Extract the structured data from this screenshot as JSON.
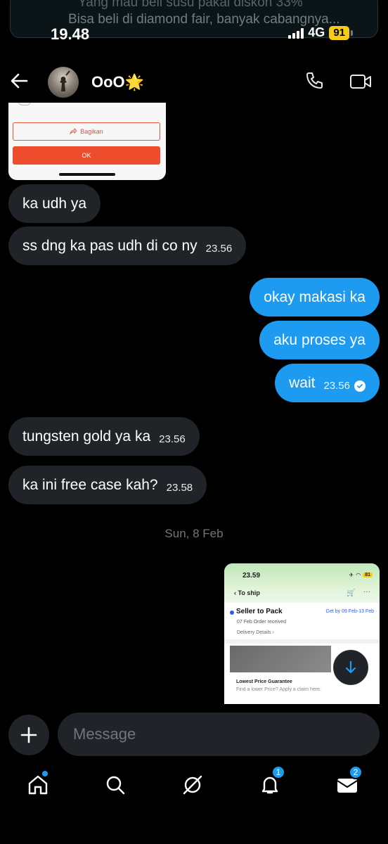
{
  "notification": {
    "line1": "Yang mau beli susu pakai diskon 33%",
    "line2": "Bisa beli di diamond fair, banyak cabangnya..."
  },
  "status_bar": {
    "time": "19.48",
    "network": "4G",
    "battery": "91"
  },
  "header": {
    "name": "OoO",
    "emoji": "🌟"
  },
  "shared_screenshot_top": {
    "share_label": "Bagikan",
    "ok_label": "OK"
  },
  "messages": [
    {
      "dir": "in",
      "text": "ka udh ya",
      "time": ""
    },
    {
      "dir": "in",
      "text": "ss dng ka pas udh di co ny",
      "time": "23.56"
    },
    {
      "dir": "out",
      "text": "okay makasi ka",
      "time": ""
    },
    {
      "dir": "out",
      "text": "aku proses ya",
      "time": ""
    },
    {
      "dir": "out",
      "text": "wait",
      "time": "23.56"
    },
    {
      "dir": "in",
      "text": "tungsten gold ya ka",
      "time": "23.56"
    },
    {
      "dir": "in",
      "text": "ka ini free case kah?",
      "time": "23.58"
    }
  ],
  "date_separator": "Sun, 8 Feb",
  "shared_screenshot_bottom": {
    "time": "23.59",
    "battery": "81",
    "nav_title": "To ship",
    "status": "Seller to Pack",
    "get_by": "Get by 09 Feb-13 Feb",
    "order_received": "07 Feb Order received",
    "delivery_details": "Delivery Details",
    "guarantee_title": "Lowest Price Guarantee",
    "guarantee_sub": "Find a lower Price? Apply a claim here."
  },
  "composer": {
    "placeholder": "Message"
  },
  "bottom_nav": {
    "home_icon": "home-icon",
    "search_icon": "search-icon",
    "grok_icon": "grok-icon",
    "notifications_badge": "1",
    "messages_badge": "2"
  },
  "colors": {
    "accent": "#1d9bf0",
    "bubble_in": "#202327",
    "background": "#000000"
  }
}
